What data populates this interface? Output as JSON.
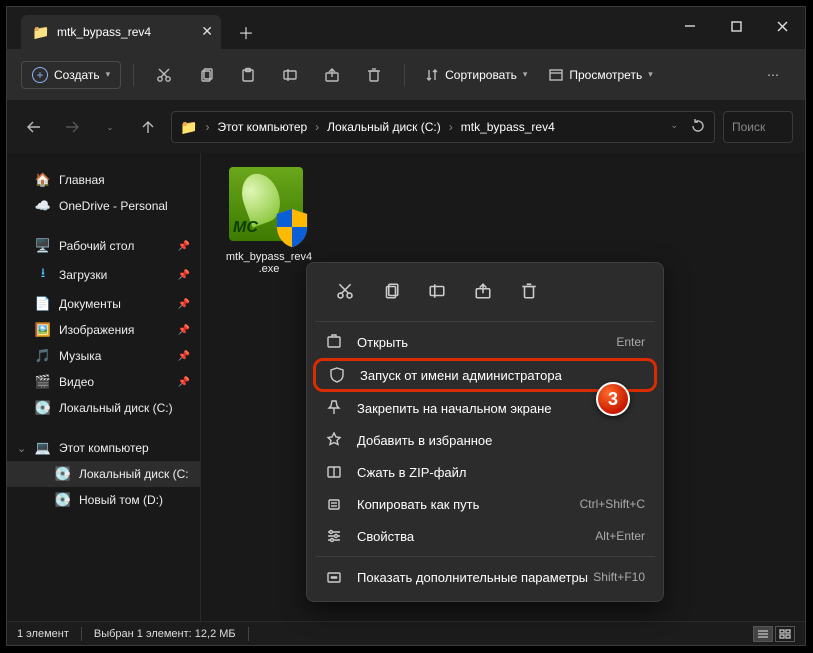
{
  "window": {
    "tab_title": "mtk_bypass_rev4"
  },
  "toolbar": {
    "create": "Создать",
    "sort": "Сортировать",
    "view": "Просмотреть"
  },
  "breadcrumbs": {
    "seg1": "Этот компьютер",
    "seg2": "Локальный диск (C:)",
    "seg3": "mtk_bypass_rev4"
  },
  "search": {
    "placeholder": "Поиск"
  },
  "sidebar": {
    "home": "Главная",
    "onedrive": "OneDrive - Personal",
    "desktop": "Рабочий стол",
    "downloads": "Загрузки",
    "documents": "Документы",
    "pictures": "Изображения",
    "music": "Музыка",
    "videos": "Видео",
    "localdisk": "Локальный диск (C:)",
    "thispc": "Этот компьютер",
    "localdisk2": "Локальный диск (C:",
    "newvol": "Новый том (D:)"
  },
  "file": {
    "name1": "mtk_bypass_rev4",
    "name2": ".exe"
  },
  "ctx": {
    "open": "Открыть",
    "open_sc": "Enter",
    "runadmin": "Запуск от имени администратора",
    "pinstart": "Закрепить на начальном экране",
    "favorite": "Добавить в избранное",
    "zip": "Сжать в ZIP-файл",
    "copypath": "Копировать как путь",
    "copypath_sc": "Ctrl+Shift+C",
    "props": "Свойства",
    "props_sc": "Alt+Enter",
    "more": "Показать дополнительные параметры",
    "more_sc": "Shift+F10"
  },
  "status": {
    "count": "1 элемент",
    "sel": "Выбран 1 элемент: 12,2 МБ"
  },
  "annotation": "3"
}
